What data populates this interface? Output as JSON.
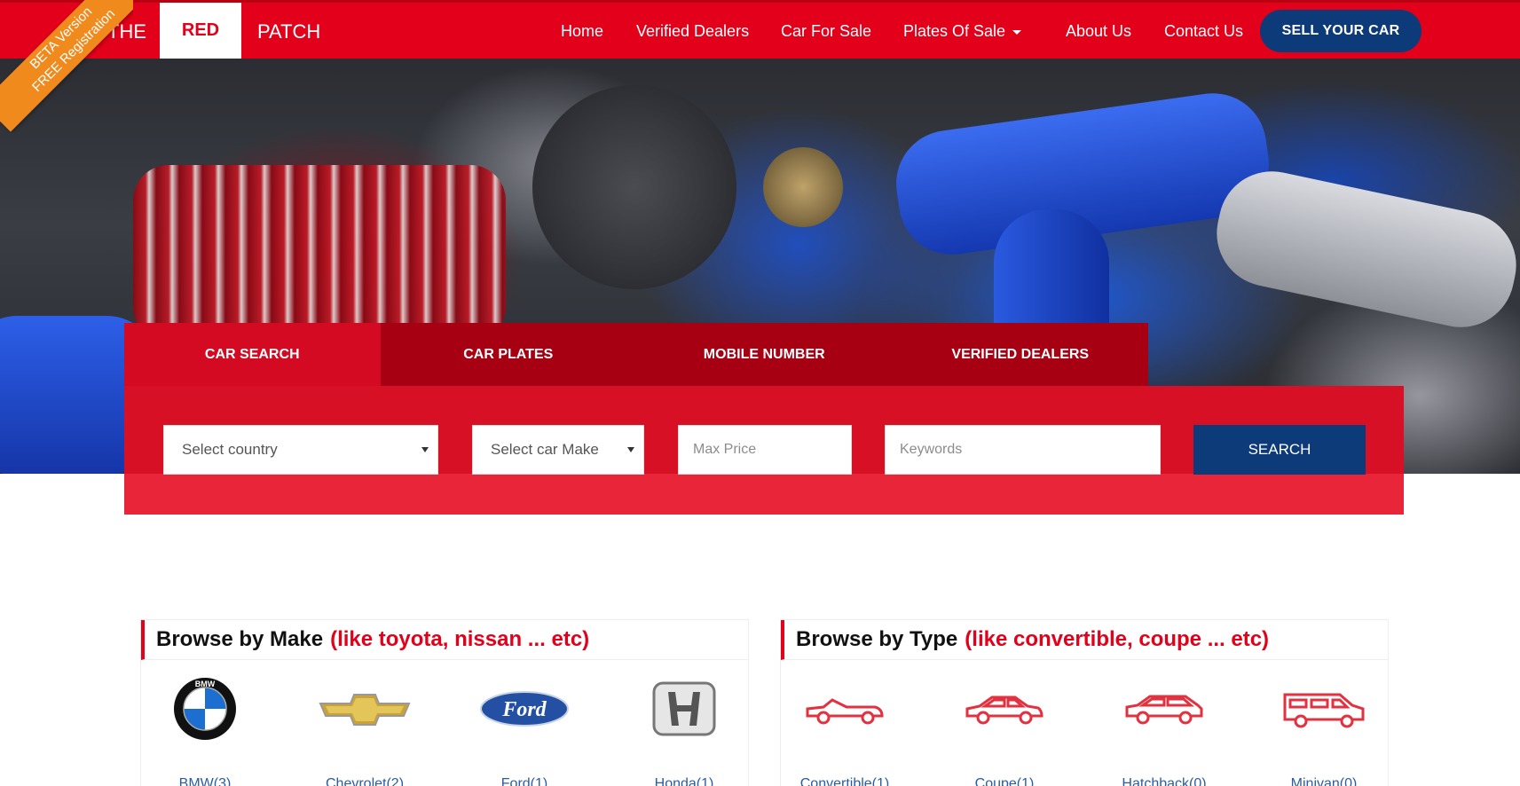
{
  "ribbon": {
    "line1": "BETA Version",
    "line2": "FREE Registration"
  },
  "logo": {
    "word1": "THE",
    "word2": "RED",
    "word3": "PATCH"
  },
  "nav": {
    "items": [
      "Home",
      "Verified Dealers",
      "Car For Sale",
      "Plates Of Sale",
      "About Us",
      "Contact Us"
    ],
    "sell_label": "SELL YOUR CAR"
  },
  "search": {
    "tabs": [
      "CAR SEARCH",
      "CAR PLATES",
      "MOBILE NUMBER",
      "VERIFIED DEALERS"
    ],
    "country_value": "Select country",
    "make_value": "Select car Make",
    "price_placeholder": "Max Price",
    "keywords_placeholder": "Keywords",
    "button_label": "SEARCH"
  },
  "browse_make": {
    "title": "Browse by Make",
    "subtitle": "(like toyota, nissan ... etc)",
    "items": [
      "BMW(3)",
      "Chevrolet(2)",
      "Ford(1)",
      "Honda(1)"
    ]
  },
  "browse_type": {
    "title": "Browse by Type",
    "subtitle": "(like convertible, coupe ... etc)",
    "items": [
      "Convertible(1)",
      "Coupe(1)",
      "Hatchback(0)",
      "Minivan(0)"
    ]
  },
  "colors": {
    "brand_red": "#e2001a",
    "navy": "#0d3a78",
    "ribbon_orange": "#f08a1d"
  }
}
